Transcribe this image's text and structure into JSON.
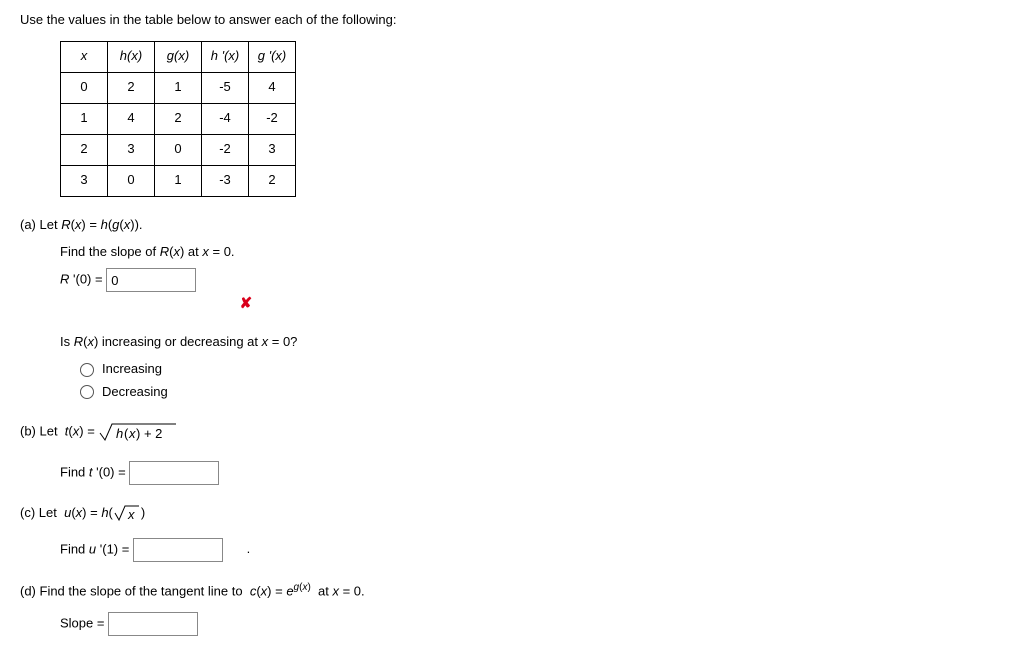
{
  "intro": "Use the values in the table below to answer each of the following:",
  "table": {
    "headers": [
      "x",
      "h(x)",
      "g(x)",
      "h '(x)",
      "g '(x)"
    ],
    "rows": [
      [
        "0",
        "2",
        "1",
        "-5",
        "4"
      ],
      [
        "1",
        "4",
        "2",
        "-4",
        "-2"
      ],
      [
        "2",
        "3",
        "0",
        "-2",
        "3"
      ],
      [
        "3",
        "0",
        "1",
        "-3",
        "2"
      ]
    ]
  },
  "a": {
    "let": "(a) Let R(x) = h(g(x)).",
    "findSlope": "Find the slope of R(x) at x = 0.",
    "rprimeLabel": "R '(0) =",
    "rprimeValue": "0",
    "isQuestion": "Is R(x) increasing or decreasing at x = 0?",
    "opt1": "Increasing",
    "opt2": "Decreasing"
  },
  "b": {
    "letPrefix": "(b) Let  t(x) = ",
    "sqrtInner": "h(x) + 2",
    "findLabel": "Find t '(0) ="
  },
  "c": {
    "letPrefix": "(c) Let  u(x) = h(",
    "sqrtInner": "x",
    "letSuffix": ")",
    "findLabel": "Find u '(1) =",
    "trailing": "."
  },
  "d": {
    "textPrefix": "(d) Find the slope of the tangent line to  c(x) = e",
    "expPrefix": "g(x)",
    "textSuffix": " at x = 0.",
    "slopeLabel": "Slope ="
  }
}
